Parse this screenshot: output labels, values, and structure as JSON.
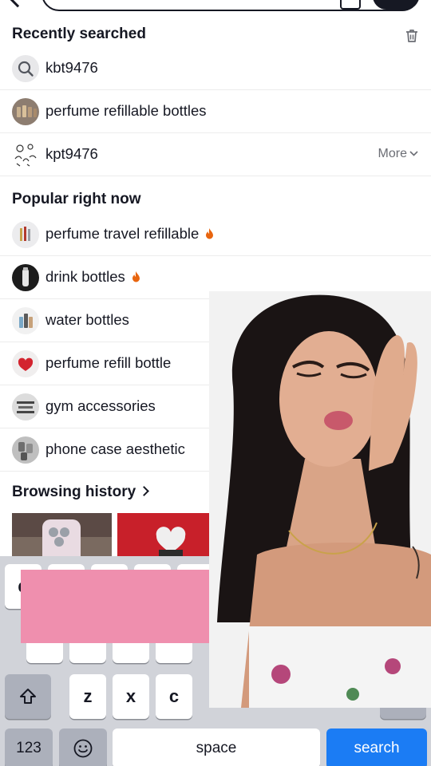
{
  "recently_searched": {
    "title": "Recently searched",
    "items": [
      {
        "label": "kbt9476"
      },
      {
        "label": "perfume refillable bottles"
      },
      {
        "label": "kpt9476"
      }
    ],
    "more_label": "More"
  },
  "popular": {
    "title": "Popular right now",
    "items": [
      {
        "label": "perfume travel refillable",
        "trending": true
      },
      {
        "label": "drink bottles",
        "trending": true
      },
      {
        "label": "water bottles",
        "trending": false
      },
      {
        "label": "perfume refill bottle",
        "trending": false
      },
      {
        "label": "gym accessories",
        "trending": false
      },
      {
        "label": "phone case aesthetic",
        "trending": false
      }
    ]
  },
  "browsing_history": {
    "title": "Browsing history"
  },
  "keyboard": {
    "row1": [
      "q"
    ],
    "row3": [
      "z",
      "x",
      "c"
    ],
    "numbers_label": "123",
    "space_label": "space",
    "search_label": "search"
  },
  "colors": {
    "accent_search": "#1b7cf4",
    "trending_fire": "#e8650f",
    "overlay_pink": "#ef8fae"
  }
}
